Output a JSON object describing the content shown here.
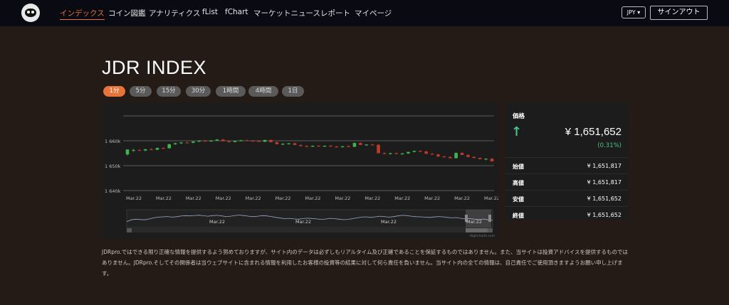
{
  "nav": {
    "items": [
      "インデックス",
      "コイン図鑑",
      "アナリティクス",
      "fList",
      "fChart",
      "マーケットニュース",
      "レポート",
      "マイページ"
    ],
    "active_index": 0,
    "currency": "JPY ▾",
    "signout": "サインアウト"
  },
  "page": {
    "title": "JDR INDEX"
  },
  "timeframes": {
    "items": [
      "1分",
      "5分",
      "15分",
      "30分",
      "1時間",
      "4時間",
      "1日"
    ],
    "active_index": 0
  },
  "chart_data": {
    "type": "candlestick",
    "y_ticks": [
      "1 660k",
      "1 650k",
      "1 640k"
    ],
    "x_ticks": [
      "Mar.22",
      "Mar.22",
      "Mar.22",
      "Mar.22",
      "Mar.22",
      "Mar.22",
      "Mar.22",
      "Mar.22",
      "Mar.22",
      "Mar.22",
      "Mar.22",
      "Mar.22",
      "Mar.22"
    ],
    "navigator_ticks": [
      "Mar.22",
      "Mar.22",
      "Mar.22",
      "Mar.22"
    ],
    "credits": "Highcharts.com",
    "up_color": "#3fb54a",
    "down_color": "#c0392b",
    "candles": [
      [
        1654500,
        1656500,
        1654000,
        1656500
      ],
      [
        1656000,
        1656800,
        1655500,
        1656300
      ],
      [
        1656300,
        1656600,
        1656000,
        1656100
      ],
      [
        1656100,
        1656700,
        1655800,
        1656600
      ],
      [
        1656600,
        1657000,
        1656200,
        1656400
      ],
      [
        1656400,
        1657300,
        1656200,
        1657100
      ],
      [
        1657100,
        1657400,
        1656800,
        1657000
      ],
      [
        1657000,
        1658800,
        1656900,
        1658600
      ],
      [
        1658600,
        1659300,
        1658300,
        1659000
      ],
      [
        1659000,
        1659500,
        1658700,
        1659300
      ],
      [
        1659300,
        1659600,
        1659000,
        1659200
      ],
      [
        1659200,
        1659900,
        1659000,
        1659700
      ],
      [
        1659700,
        1660200,
        1659400,
        1660000
      ],
      [
        1660000,
        1660400,
        1659700,
        1659800
      ],
      [
        1659800,
        1660300,
        1659500,
        1660100
      ],
      [
        1660100,
        1660700,
        1659900,
        1660500
      ],
      [
        1660500,
        1660800,
        1660000,
        1659800
      ],
      [
        1659800,
        1660100,
        1659300,
        1659500
      ],
      [
        1659500,
        1660100,
        1659300,
        1659900
      ],
      [
        1659900,
        1660400,
        1659700,
        1660200
      ],
      [
        1660200,
        1660500,
        1659900,
        1660000
      ],
      [
        1660000,
        1660300,
        1659700,
        1659900
      ],
      [
        1659900,
        1660200,
        1659500,
        1659600
      ],
      [
        1659600,
        1660500,
        1659500,
        1660300
      ],
      [
        1660300,
        1660600,
        1659700,
        1659400
      ],
      [
        1659400,
        1659700,
        1658900,
        1658600
      ],
      [
        1658600,
        1659000,
        1658200,
        1658800
      ],
      [
        1658800,
        1659100,
        1658400,
        1659000
      ],
      [
        1659000,
        1659300,
        1658500,
        1658300
      ],
      [
        1658300,
        1658600,
        1657700,
        1657900
      ],
      [
        1657900,
        1658200,
        1657400,
        1657700
      ],
      [
        1657700,
        1658100,
        1657400,
        1658000
      ],
      [
        1658000,
        1658300,
        1657600,
        1657800
      ],
      [
        1657800,
        1658100,
        1657500,
        1658000
      ],
      [
        1658000,
        1658400,
        1657800,
        1657700
      ],
      [
        1657700,
        1658000,
        1657300,
        1657500
      ],
      [
        1657500,
        1657900,
        1657200,
        1657800
      ],
      [
        1657800,
        1658200,
        1657500,
        1657600
      ],
      [
        1657600,
        1659300,
        1657400,
        1659100
      ],
      [
        1659100,
        1659500,
        1658700,
        1658300
      ],
      [
        1658300,
        1658600,
        1658000,
        1658500
      ],
      [
        1658500,
        1658800,
        1658200,
        1658400
      ],
      [
        1658400,
        1658600,
        1655000,
        1655000
      ],
      [
        1655000,
        1655400,
        1654700,
        1654800
      ],
      [
        1654800,
        1655200,
        1654500,
        1655000
      ],
      [
        1655000,
        1655300,
        1654600,
        1654700
      ],
      [
        1654700,
        1655100,
        1654400,
        1654900
      ],
      [
        1654900,
        1655600,
        1654700,
        1655500
      ],
      [
        1655500,
        1656100,
        1655300,
        1655900
      ],
      [
        1655900,
        1656300,
        1655600,
        1655700
      ],
      [
        1655700,
        1656000,
        1654600,
        1654800
      ],
      [
        1654800,
        1655100,
        1654400,
        1654500
      ],
      [
        1654500,
        1654800,
        1653500,
        1653700
      ],
      [
        1653700,
        1654000,
        1653300,
        1653500
      ],
      [
        1653500,
        1653800,
        1652800,
        1653000
      ],
      [
        1653000,
        1655300,
        1652900,
        1655100
      ],
      [
        1655100,
        1655400,
        1654700,
        1654300
      ],
      [
        1654300,
        1654600,
        1653300,
        1653500
      ],
      [
        1653500,
        1653800,
        1652900,
        1653100
      ],
      [
        1653100,
        1653400,
        1652500,
        1652600
      ],
      [
        1652600,
        1652900,
        1652200,
        1652800
      ],
      [
        1652800,
        1653000,
        1652200,
        1651700
      ]
    ],
    "navigator_line": [
      30,
      42,
      46,
      44,
      42,
      48,
      55,
      60,
      62,
      64,
      60,
      63,
      67,
      70,
      68,
      71,
      73,
      69,
      66,
      70,
      72,
      68,
      64,
      66,
      71,
      74,
      70,
      66,
      63,
      66,
      70,
      68,
      64,
      58,
      54,
      50,
      52,
      48,
      46,
      50,
      53,
      51,
      48,
      45,
      47,
      52,
      50,
      46,
      43,
      45,
      50,
      55,
      60,
      62,
      58,
      62,
      66,
      64,
      60,
      63,
      68,
      72,
      70,
      66,
      63,
      62,
      60,
      58,
      61,
      64,
      62,
      58,
      55,
      57,
      52,
      48,
      50,
      46,
      44,
      47,
      42,
      40
    ]
  },
  "price_panel": {
    "label": "価格",
    "arrow": "↑",
    "price": "¥ 1,651,652",
    "change": "(0.31%)",
    "rows": [
      {
        "k": "始値",
        "v": "¥ 1,651,817"
      },
      {
        "k": "高値",
        "v": "¥ 1,651,817"
      },
      {
        "k": "安値",
        "v": "¥ 1,651,652"
      },
      {
        "k": "終値",
        "v": "¥ 1,651,652"
      }
    ]
  },
  "disclaimer": {
    "line1": "JDRpro.ではできる限り正確な情報を提供するよう努めておりますが、サイト内のデータは必ずしもリアルタイム及び正確であることを保証するものではありません。また、当サイトは投資アドバイスを提供するものではありません。JDRpro.そしてその関係者は当ウェブサイトに含まれる情報を利用したお客様の投資等の結果に対して何ら責任を負いません。当サイト内の全ての情報は、自己責任でご使用頂きますようお願い申し上げます。"
  }
}
